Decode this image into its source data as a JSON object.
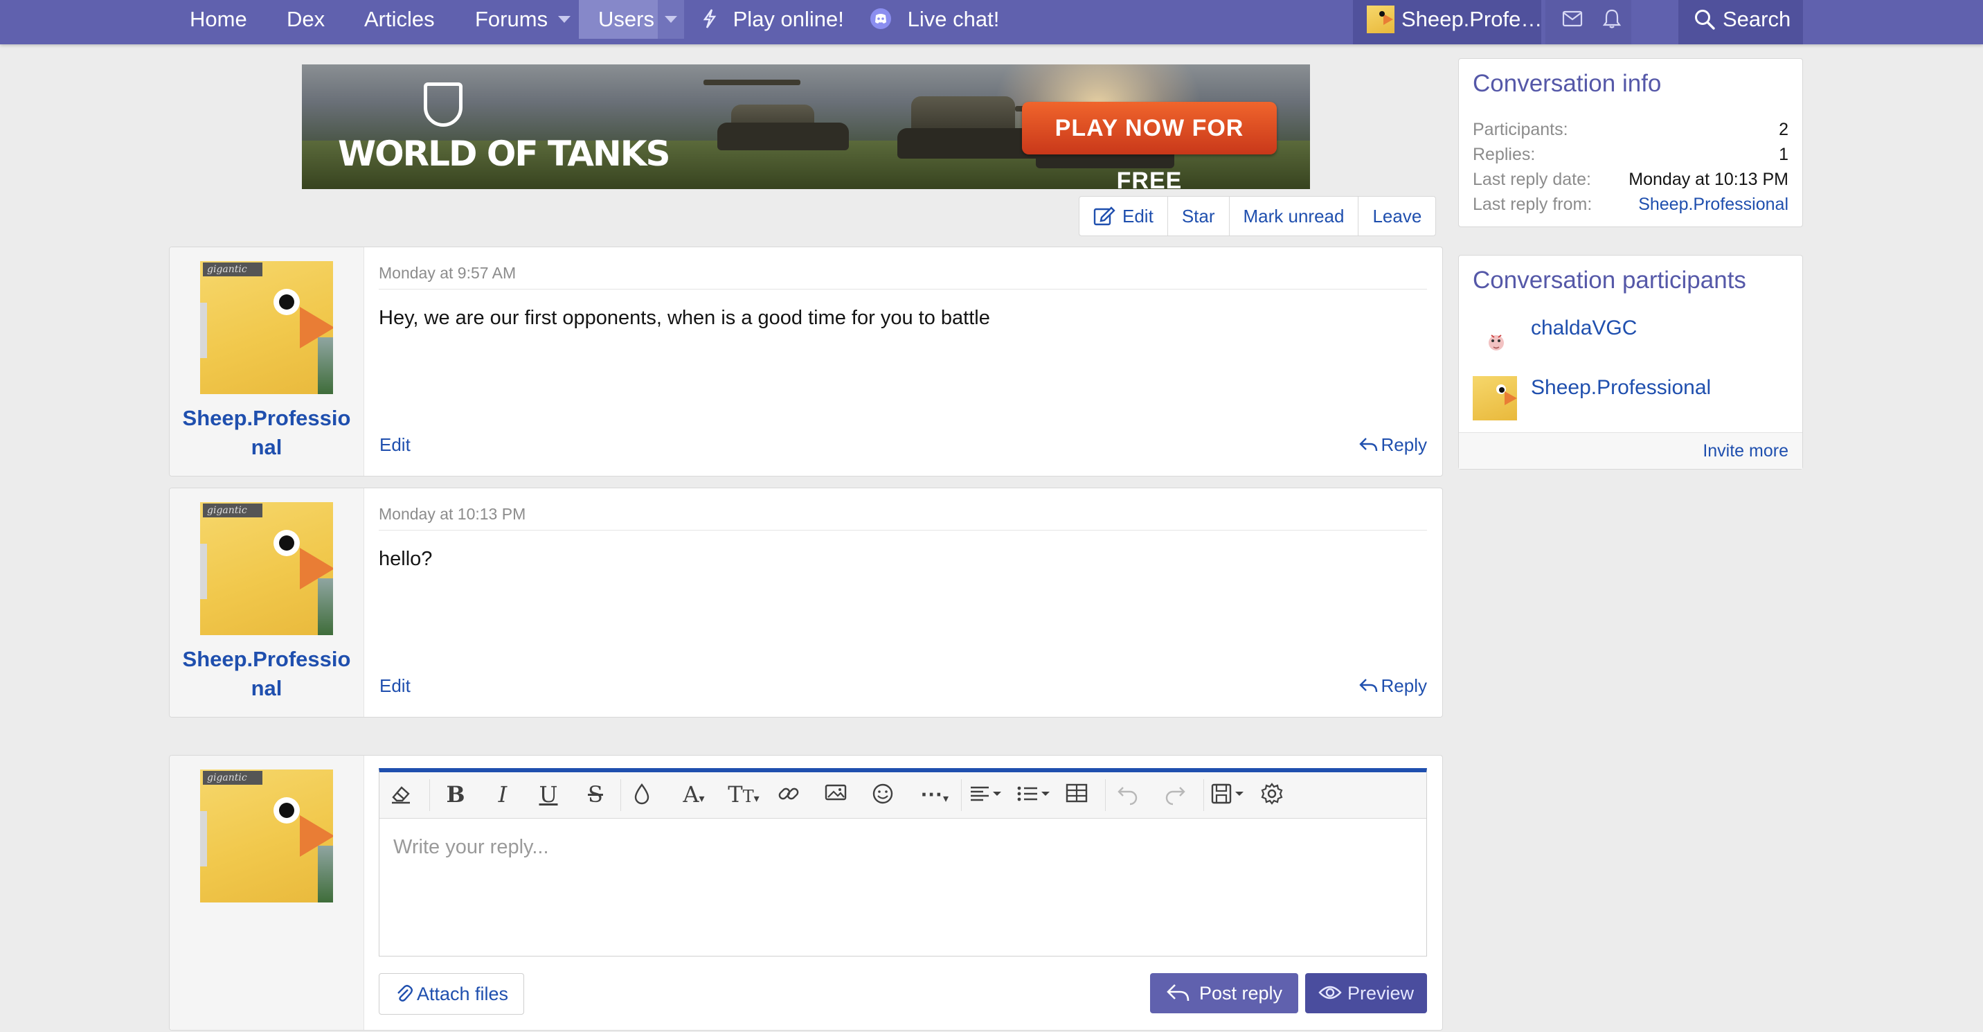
{
  "nav": {
    "home": "Home",
    "dex": "Dex",
    "articles": "Articles",
    "forums": "Forums",
    "users": "Users",
    "play_online": "Play online!",
    "live_chat": "Live chat!",
    "account": "Sheep.Profe…",
    "search": "Search"
  },
  "banner": {
    "brand": "WORLD OF TANKS",
    "cta": "PLAY NOW FOR FREE"
  },
  "actions": {
    "edit": "Edit",
    "star": "Star",
    "mark_unread": "Mark unread",
    "leave": "Leave"
  },
  "messages": [
    {
      "username_line1": "Sheep.Professio",
      "username_line2": "nal",
      "timestamp": "Monday at 9:57 AM",
      "body": "Hey, we are our first opponents, when is a good time for you to battle",
      "edit": "Edit",
      "reply": "Reply"
    },
    {
      "username_line1": "Sheep.Professio",
      "username_line2": "nal",
      "timestamp": "Monday at 10:13 PM",
      "body": "hello?",
      "edit": "Edit",
      "reply": "Reply"
    }
  ],
  "editor": {
    "placeholder": "Write your reply...",
    "attach": "Attach files",
    "post_reply": "Post reply",
    "preview": "Preview"
  },
  "avatar_tag": "gigantic",
  "conversation_info": {
    "title": "Conversation info",
    "rows": [
      {
        "label": "Participants:",
        "value": "2"
      },
      {
        "label": "Replies:",
        "value": "1"
      },
      {
        "label": "Last reply date:",
        "value": "Monday at 10:13 PM"
      },
      {
        "label": "Last reply from:",
        "value": "Sheep.Professional"
      }
    ]
  },
  "participants": {
    "title": "Conversation participants",
    "list": [
      "chaldaVGC",
      "Sheep.Professional"
    ],
    "invite": "Invite more"
  },
  "colors": {
    "nav_bg": "#6061ae",
    "link": "#1f4fae",
    "accent_button": "#6061ae"
  }
}
